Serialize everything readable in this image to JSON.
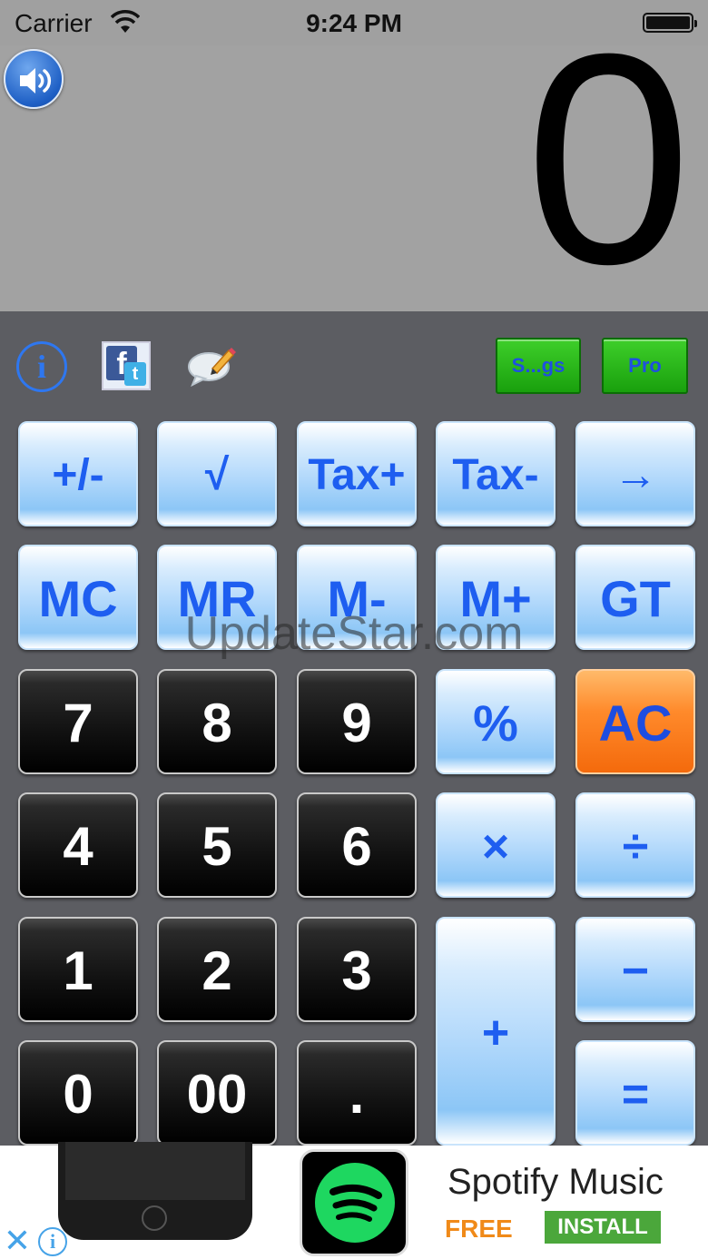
{
  "status_bar": {
    "carrier": "Carrier",
    "time": "9:24 PM",
    "battery_level": 1.0
  },
  "display": {
    "value": "0",
    "speaker_icon": "speaker-volume-icon"
  },
  "utility_row": {
    "info_icon": "i",
    "facebook_icon_letter": "f",
    "twitter_icon_letter": "t",
    "chat_icon": "speech-bubble-pencil-icon",
    "settings_label": "S...gs",
    "pro_label": "Pro"
  },
  "keys": {
    "plus_minus": "+/-",
    "sqrt": "√",
    "tax_plus": "Tax+",
    "tax_minus": "Tax-",
    "arrow": "→",
    "mc": "MC",
    "mr": "MR",
    "m_minus": "M-",
    "m_plus": "M+",
    "gt": "GT",
    "seven": "7",
    "eight": "8",
    "nine": "9",
    "percent": "%",
    "ac": "AC",
    "four": "4",
    "five": "5",
    "six": "6",
    "multiply": "×",
    "divide": "÷",
    "one": "1",
    "two": "2",
    "three": "3",
    "plus": "+",
    "minus": "−",
    "zero": "0",
    "double_zero": "00",
    "decimal": ".",
    "equals": "="
  },
  "watermark": "UpdateStar.com",
  "ad": {
    "title": "Spotify Music",
    "free_label": "FREE",
    "install_label": "INSTALL",
    "close_symbol": "✕",
    "info_symbol": "i"
  },
  "colors": {
    "key_blue_text": "#1e5ef0",
    "ac_orange": "#f46a0c",
    "spotify_green": "#1ed760",
    "install_green": "#4ba73b",
    "free_orange": "#f08a19"
  }
}
